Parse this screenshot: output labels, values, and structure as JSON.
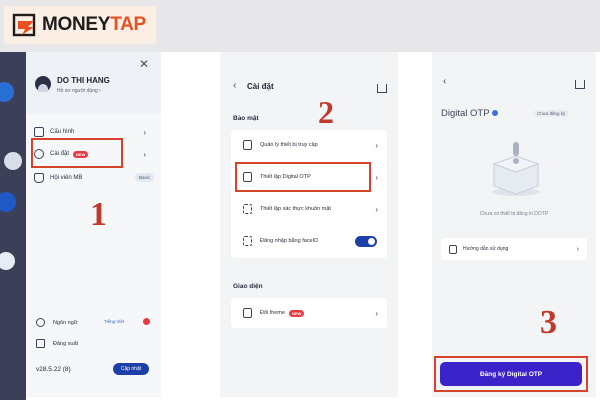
{
  "brand": {
    "logo_left": "MONEY",
    "logo_right": "TAP"
  },
  "panel1": {
    "user_name": "DO THI HANG",
    "user_sub": "Hồ sơ người dùng  ›",
    "menu": [
      {
        "label": "Cấu hình"
      },
      {
        "label": "Cài đặt",
        "badge": "NEW"
      },
      {
        "label": "Hội viên MB",
        "badge": "Basic"
      }
    ],
    "language_label": "Ngôn ngữ",
    "language_value": "Tiếng Việt",
    "logout_label": "Đăng xuất",
    "version": "v28.5.22 (8)",
    "update_label": "Cập nhật",
    "step": "1"
  },
  "panel2": {
    "title": "Cài đặt",
    "section_security": "Bảo mật",
    "rows": [
      {
        "label": "Quản lý thiết bị truy cập"
      },
      {
        "label": "Thiết lập Digital OTP"
      },
      {
        "label": "Thiết lập xác thực khuôn mặt"
      },
      {
        "label": "Đăng nhập bằng faceID"
      }
    ],
    "section_ui": "Giao diện",
    "theme_label": "Đổi theme",
    "theme_badge": "NEW",
    "step": "2"
  },
  "panel3": {
    "title": "Digital OTP",
    "status": "Chưa đăng ký",
    "empty_text": "Chưa có thiết bị đăng kí DOTP",
    "guide_label": "Hướng dẫn sử dụng",
    "register_label": "Đăng ký Digital OTP",
    "step": "3"
  },
  "colors": {
    "accent": "#3b22c9",
    "primary": "#1d3fa8",
    "highlight": "#d4432a",
    "brand_orange": "#e8501f"
  }
}
